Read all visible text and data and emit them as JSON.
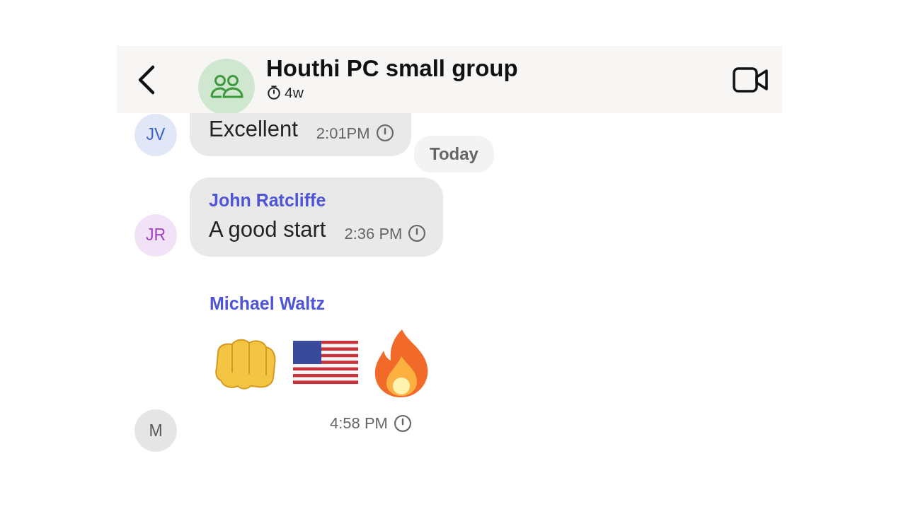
{
  "header": {
    "title": "Houthi PC small group",
    "timer": "4w"
  },
  "messages": [
    {
      "kind": "text",
      "initials": "JV",
      "color": "#3a5fc8",
      "text": "Excellent",
      "time": "2:01PM"
    },
    {
      "kind": "date",
      "text": "Today"
    },
    {
      "kind": "text",
      "initials": "JR",
      "color": "#a03cc8",
      "sender": "John Ratcliffe",
      "text": "A good start",
      "time": "2:36 PM"
    },
    {
      "kind": "emoji",
      "initials": "M",
      "color": "#5a5a5a",
      "sender": "Michael Waltz",
      "time": "4:58 PM"
    }
  ]
}
